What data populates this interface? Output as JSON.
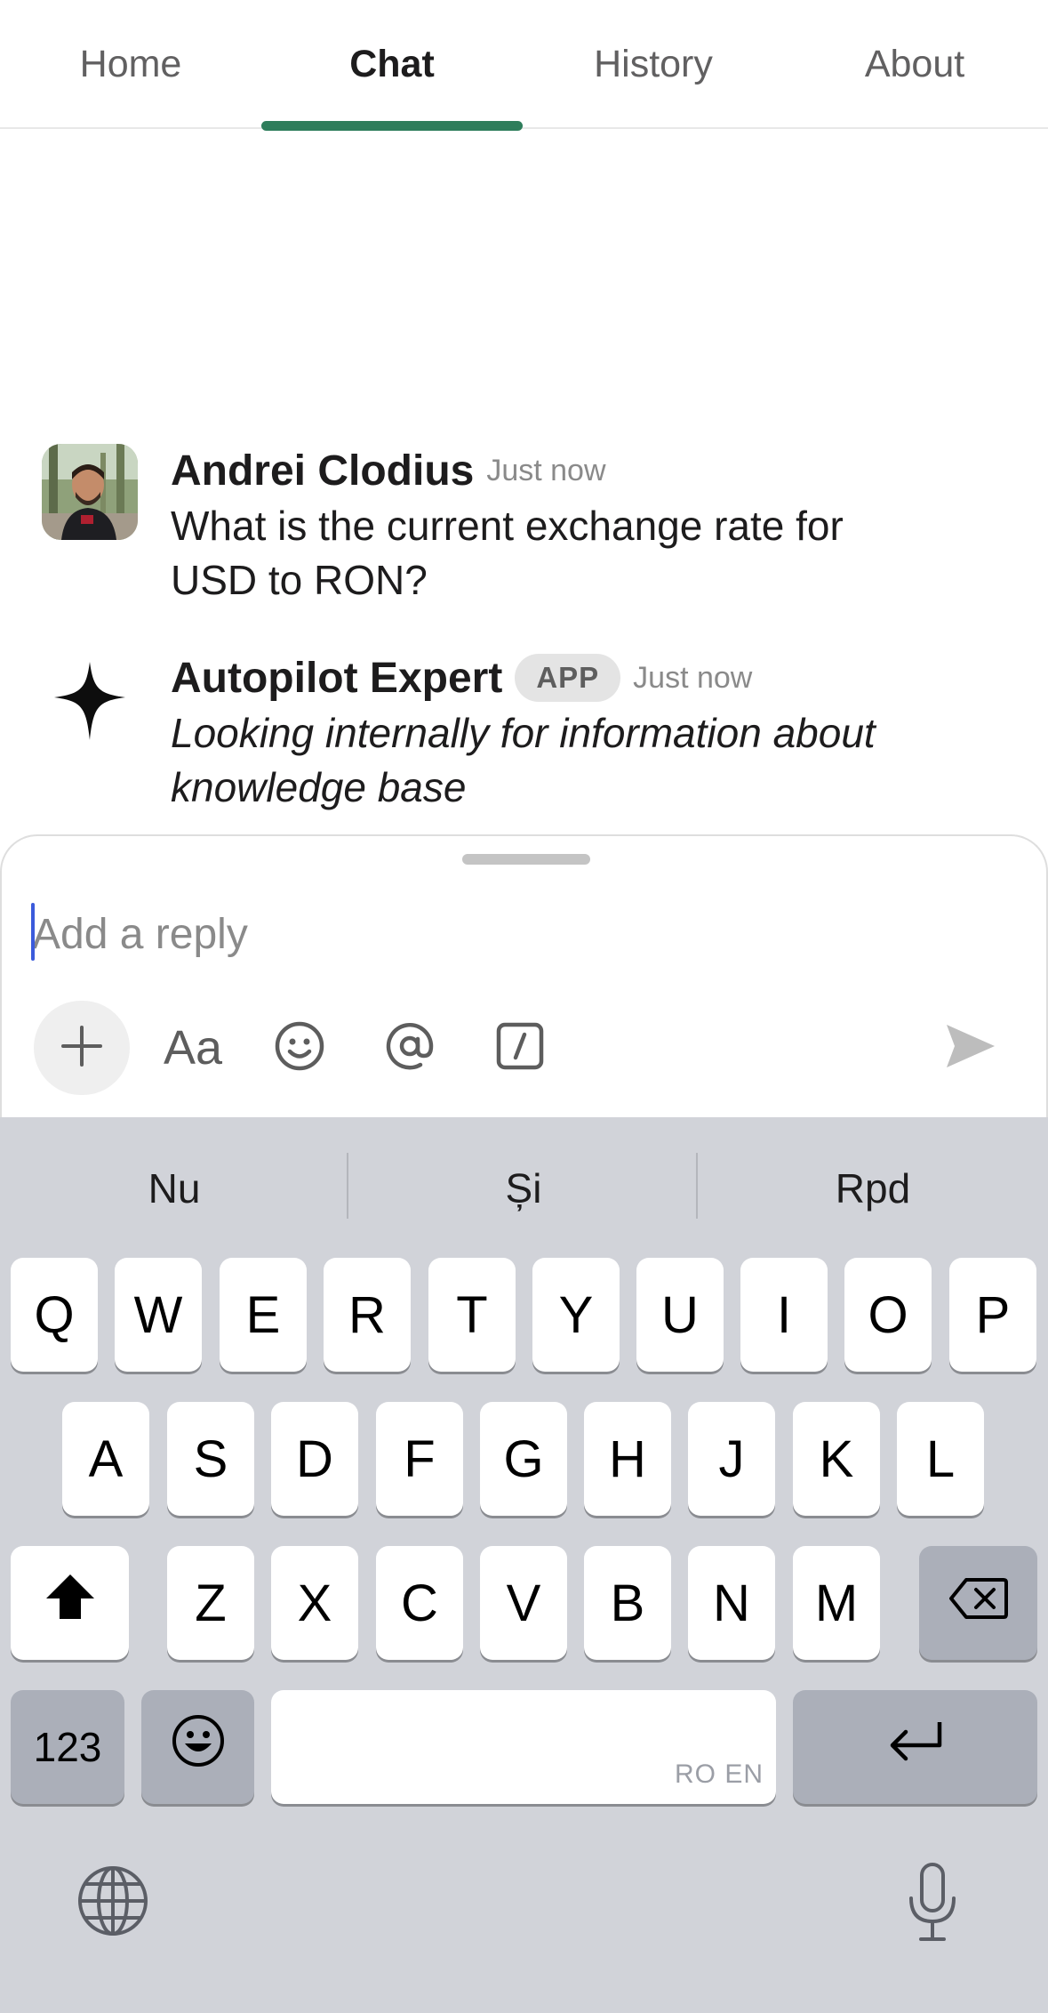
{
  "tabs": [
    {
      "label": "Home"
    },
    {
      "label": "Chat",
      "active": true
    },
    {
      "label": "History"
    },
    {
      "label": "About"
    }
  ],
  "messages": [
    {
      "author": "Andrei Clodius",
      "time": "Just now",
      "text_line1": "What is the current exchange rate for",
      "text_line2": "USD to RON?"
    },
    {
      "author": "Autopilot Expert",
      "badge": "APP",
      "time": "Just now",
      "text_line1": "Looking internally for information about",
      "text_line2": "knowledge base"
    }
  ],
  "composer": {
    "placeholder": "Add a reply",
    "format_label": "Aa",
    "icons": [
      "plus-icon",
      "text-format-icon",
      "emoji-icon",
      "mention-icon",
      "slash-command-icon",
      "send-icon"
    ]
  },
  "keyboard": {
    "suggestions": [
      "Nu",
      "Și",
      "Rpd"
    ],
    "row1": [
      "Q",
      "W",
      "E",
      "R",
      "T",
      "Y",
      "U",
      "I",
      "O",
      "P"
    ],
    "row2": [
      "A",
      "S",
      "D",
      "F",
      "G",
      "H",
      "J",
      "K",
      "L"
    ],
    "row3": [
      "Z",
      "X",
      "C",
      "V",
      "B",
      "N",
      "M"
    ],
    "numbers_label": "123",
    "space_hint": "RO EN"
  },
  "colors": {
    "tab_indicator": "#2e7d5b",
    "keyboard_bg": "#d1d3d9",
    "caret": "#3b5bdb"
  }
}
